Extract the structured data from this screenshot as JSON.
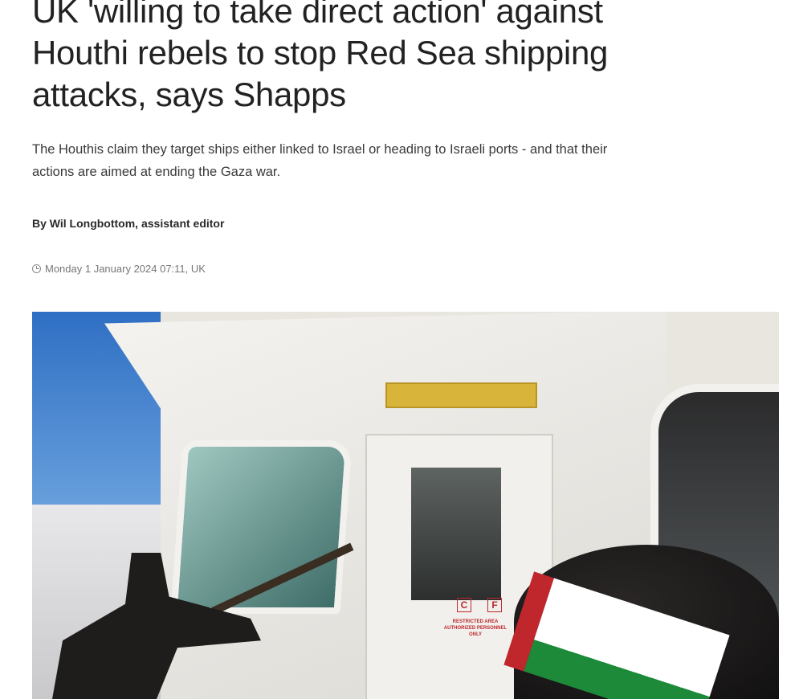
{
  "article": {
    "headline": "UK 'willing to take direct action' against Houthi rebels to stop Red Sea shipping attacks, says Shapps",
    "standfirst": "The Houthis claim they target ships either linked to Israel or heading to Israeli ports - and that their actions are aimed at ending the Gaza war.",
    "byline": "By Wil Longbottom, assistant editor",
    "date": "Monday 1 January 2024 07:11, UK",
    "date_icon": "clock-icon"
  },
  "photo": {
    "door_sign": "RESTRICTED AREA AUTHORIZED PERSONNEL ONLY",
    "label_c": "C",
    "label_f": "F"
  }
}
